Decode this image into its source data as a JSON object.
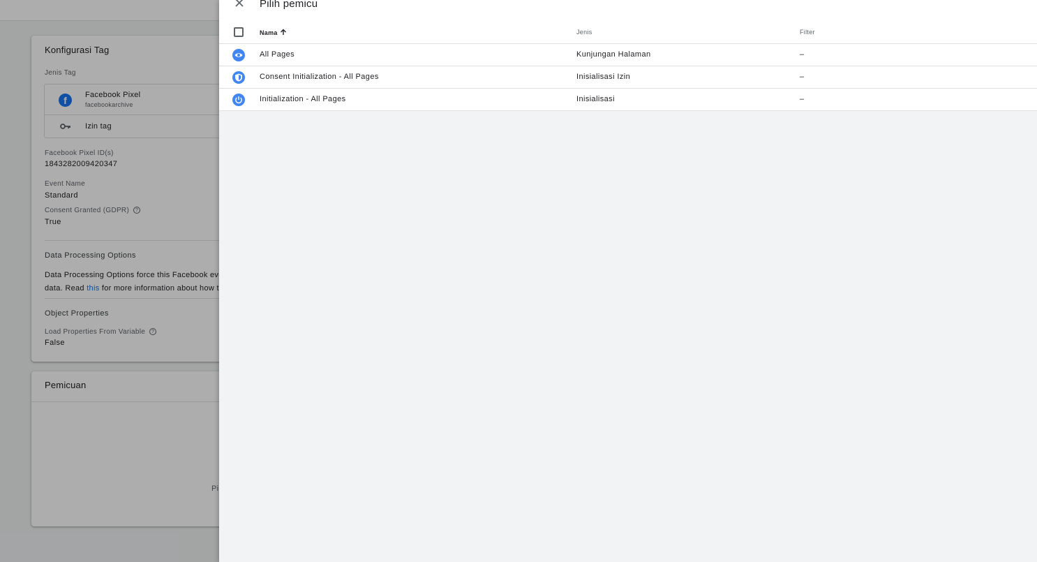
{
  "background": {
    "config_card": {
      "title": "Konfigurasi Tag",
      "tag_type_label": "Jenis Tag",
      "tag_type_name": "Facebook Pixel",
      "tag_type_sub": "facebookarchive",
      "tag_permission": "Izin tag",
      "fields": [
        {
          "label": "Facebook Pixel ID(s)",
          "value": "1843282009420347"
        },
        {
          "label": "Event Name",
          "value": "Standard"
        },
        {
          "label": "Consent Granted (GDPR)",
          "value": "True"
        }
      ],
      "dpo_heading": "Data Processing Options",
      "dpo_text_line1": "Data Processing Options force this Facebook eve",
      "dpo_text_line2_pre": "data. Read ",
      "dpo_text_link": "this",
      "dpo_text_line2_post": " for more information about how t",
      "object_heading": "Object Properties",
      "load_props_label": "Load Properties From Variable",
      "load_props_value": "False"
    },
    "trigger_card": {
      "title": "Pemicuan",
      "hint": "Pi"
    }
  },
  "panel": {
    "title": "Pilih pemicu",
    "columns": {
      "name": "Nama",
      "type": "Jenis",
      "filter": "Filter"
    },
    "rows": [
      {
        "name": "All Pages",
        "type": "Kunjungan Halaman",
        "filter": "–",
        "icon": "eye-icon"
      },
      {
        "name": "Consent Initialization - All Pages",
        "type": "Inisialisasi Izin",
        "filter": "–",
        "icon": "shield-icon"
      },
      {
        "name": "Initialization - All Pages",
        "type": "Inisialisasi",
        "filter": "–",
        "icon": "power-icon"
      }
    ]
  },
  "colors": {
    "accent": "#4285f4",
    "link": "#1a73e8",
    "panel_bg": "#f1f3f4"
  }
}
